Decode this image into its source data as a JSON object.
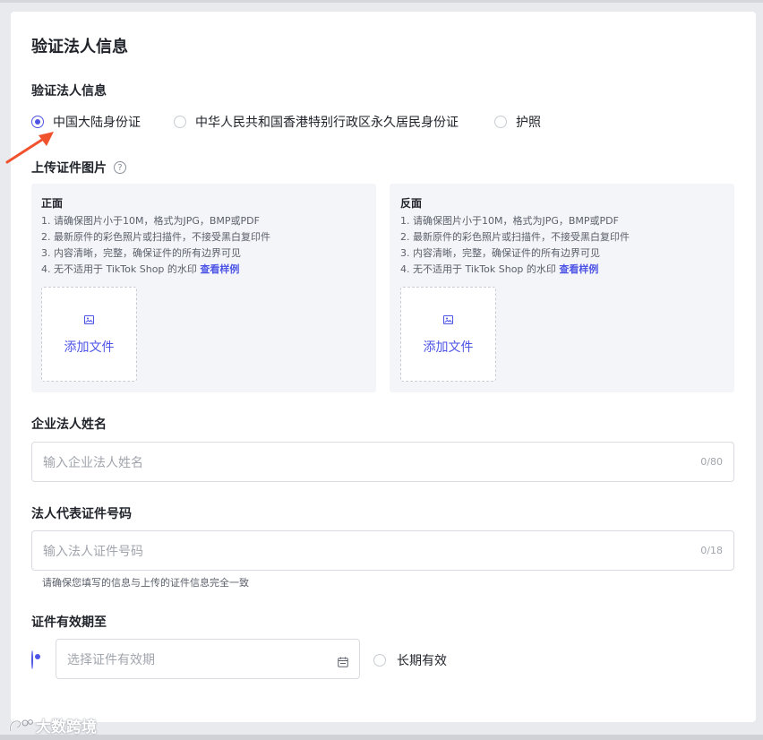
{
  "page": {
    "title": "验证法人信息"
  },
  "id_type": {
    "label": "验证法人信息",
    "options": [
      {
        "label": "中国大陆身份证",
        "selected": true
      },
      {
        "label": "中华人民共和国香港特别行政区永久居民身份证",
        "selected": false
      },
      {
        "label": "护照",
        "selected": false
      }
    ]
  },
  "upload": {
    "label": "上传证件图片",
    "help_icon": "question-circle-icon",
    "help_glyph": "?",
    "panels": [
      {
        "title": "正面",
        "rules": [
          "1. 请确保图片小于10M，格式为JPG，BMP或PDF",
          "2. 最新原件的彩色照片或扫描件，不接受黑白复印件",
          "3. 内容清晰，完整，确保证件的所有边界可见",
          "4. 无不适用于 TikTok Shop 的水印"
        ],
        "example_link": "查看样例",
        "button_label": "添加文件",
        "icon": "image-icon"
      },
      {
        "title": "反面",
        "rules": [
          "1. 请确保图片小于10M，格式为JPG，BMP或PDF",
          "2. 最新原件的彩色照片或扫描件，不接受黑白复印件",
          "3. 内容清晰，完整，确保证件的所有边界可见",
          "4. 无不适用于 TikTok Shop 的水印"
        ],
        "example_link": "查看样例",
        "button_label": "添加文件",
        "icon": "image-icon"
      }
    ]
  },
  "legal_name": {
    "label": "企业法人姓名",
    "placeholder": "输入企业法人姓名",
    "counter": "0/80"
  },
  "id_number": {
    "label": "法人代表证件号码",
    "placeholder": "输入法人证件号码",
    "counter": "0/18",
    "hint": "请确保您填写的信息与上传的证件信息完全一致"
  },
  "validity": {
    "label": "证件有效期至",
    "date_placeholder": "选择证件有效期",
    "date_icon": "calendar-icon",
    "long_term_label": "长期有效",
    "date_selected": true,
    "long_term_selected": false
  },
  "watermark": {
    "text": "大数跨境"
  },
  "colors": {
    "accent": "#4e55e6",
    "arrow": "#f0522e",
    "panel_bg": "#f4f5f8"
  }
}
